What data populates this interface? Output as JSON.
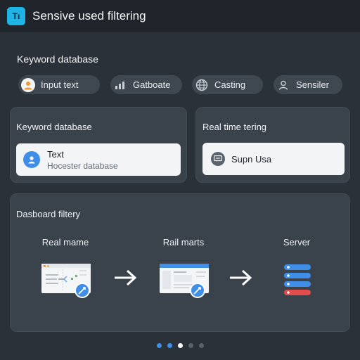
{
  "window": {
    "logo_text": "Tı",
    "title": "Sensive used filtering"
  },
  "keyword_section": {
    "title": "Keyword database",
    "chips": [
      {
        "label": "Input text",
        "icon": "user-icon"
      },
      {
        "label": "Gatboate",
        "icon": "bar-chart-icon"
      },
      {
        "label": "Casting",
        "icon": "globe-icon"
      },
      {
        "label": "Sensiler",
        "icon": "person-icon"
      }
    ]
  },
  "keyword_panel": {
    "title": "Keyword database",
    "card": {
      "line1": "Text",
      "line2": "Hocester database",
      "icon": "person-circle-icon"
    }
  },
  "realtime_panel": {
    "title": "Real time tering",
    "card": {
      "line1": "Supn Usa",
      "icon": "chat-icon"
    }
  },
  "dashboard_panel": {
    "title": "Dasboard filtery",
    "steps": [
      {
        "label": "Real mame",
        "icon": "document-filter-icon"
      },
      {
        "label": "Rail marts",
        "icon": "browser-window-icon"
      },
      {
        "label": "Server",
        "icon": "server-stack-icon"
      }
    ]
  },
  "pager": {
    "count": 5,
    "active": 2
  },
  "colors": {
    "accent": "#1fb4e6",
    "blue": "#3f8ee8",
    "red": "#e14b4b",
    "background": "#2b3138"
  }
}
